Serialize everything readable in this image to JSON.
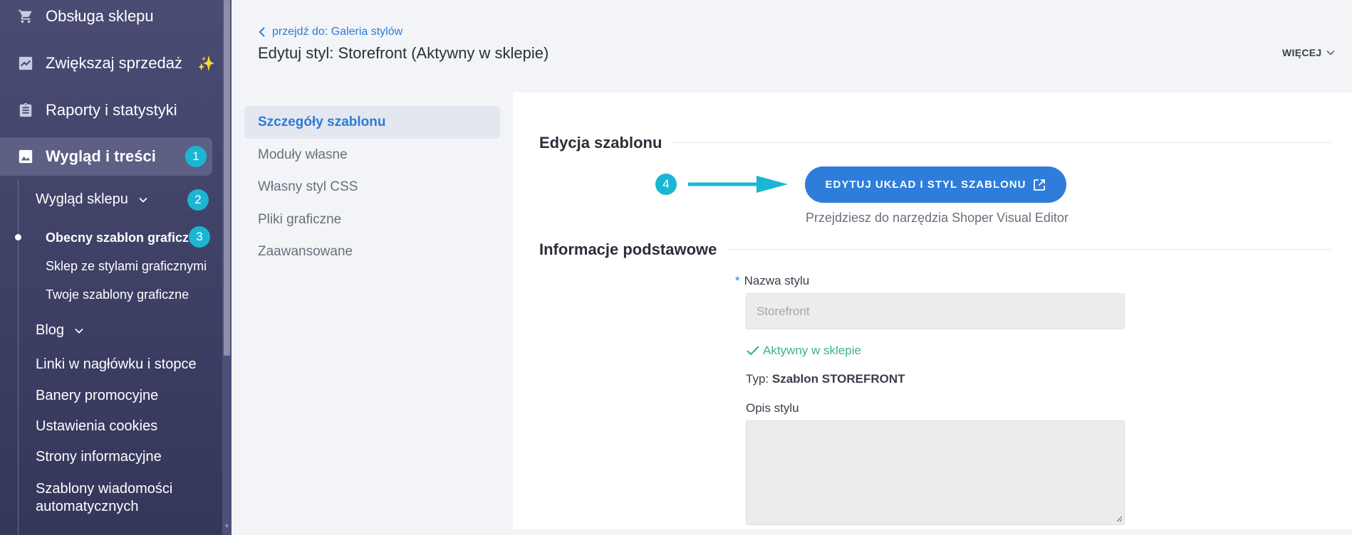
{
  "sidebar": {
    "main_items": [
      {
        "label": "Obsługa sklepu",
        "icon": "cart-icon"
      },
      {
        "label": "Zwiększaj sprzedaż",
        "icon": "trending-up-icon"
      },
      {
        "label": "Raporty i statystyki",
        "icon": "clipboard-icon"
      },
      {
        "label": "Wygląd i treści",
        "icon": "image-icon",
        "active": true
      }
    ],
    "sub_items": [
      {
        "label": "Wygląd sklepu"
      },
      {
        "label": "Blog"
      },
      {
        "label": "Linki w nagłówku i stopce"
      },
      {
        "label": "Banery promocyjne"
      },
      {
        "label": "Ustawienia cookies"
      },
      {
        "label": "Strony informacyjne"
      },
      {
        "label": "Szablony wiadomości",
        "label2": "automatycznych"
      }
    ],
    "sub2_items": [
      {
        "label": "Obecny szablon graficzny",
        "active": true
      },
      {
        "label": "Sklep ze stylami graficznymi"
      },
      {
        "label": "Twoje szablony graficzne"
      }
    ],
    "badges": [
      "1",
      "2",
      "3"
    ]
  },
  "header": {
    "breadcrumb": "przejdź do: Galeria stylów",
    "title": "Edytuj styl: Storefront (Aktywny w sklepie)",
    "more_label": "WIĘCEJ"
  },
  "inner_menu": [
    {
      "label": "Szczegóły szablonu",
      "active": true
    },
    {
      "label": "Moduły własne"
    },
    {
      "label": "Własny styl CSS"
    },
    {
      "label": "Pliki graficzne"
    },
    {
      "label": "Zaawansowane"
    }
  ],
  "edit_section": {
    "title": "Edycja szablonu",
    "step_badge": "4",
    "button_label": "EDYTUJ UKŁAD I STYL SZABLONU",
    "hint": "Przejdziesz do narzędzia Shoper Visual Editor"
  },
  "basic_section": {
    "title": "Informacje podstawowe",
    "name_label": "Nazwa stylu",
    "required_mark": "*",
    "name_value": "Storefront",
    "status": "Aktywny w sklepie",
    "type_prefix": "Typ:",
    "type_value": "Szablon STOREFRONT",
    "desc_label": "Opis stylu",
    "desc_value": ""
  },
  "colors": {
    "sidebar_bg": "#44466c",
    "accent": "#2f7ddb",
    "badge": "#1bb6d3",
    "success": "#3fb28a"
  }
}
